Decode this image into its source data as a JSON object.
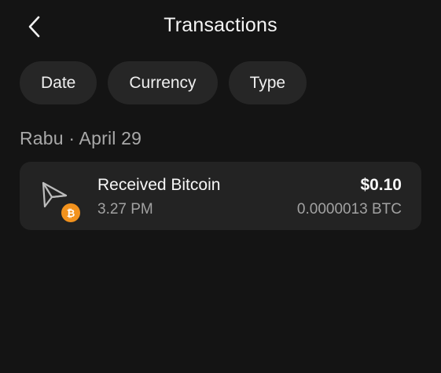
{
  "header": {
    "title": "Transactions",
    "back_icon": "chevron-left-icon"
  },
  "filters": [
    {
      "label": "Date"
    },
    {
      "label": "Currency"
    },
    {
      "label": "Type"
    }
  ],
  "sections": [
    {
      "label": "Rabu · April 29",
      "transactions": [
        {
          "icon": "send-arrow-icon",
          "badge_icon": "bitcoin-icon",
          "badge_color": "#f2921d",
          "title": "Received Bitcoin",
          "time": "3.27 PM",
          "amount_usd": "$0.10",
          "amount_btc": "0.0000013 BTC"
        }
      ]
    }
  ],
  "colors": {
    "background": "#141414",
    "card": "#232323",
    "chip": "#262626",
    "accent_btc": "#f2921d"
  }
}
